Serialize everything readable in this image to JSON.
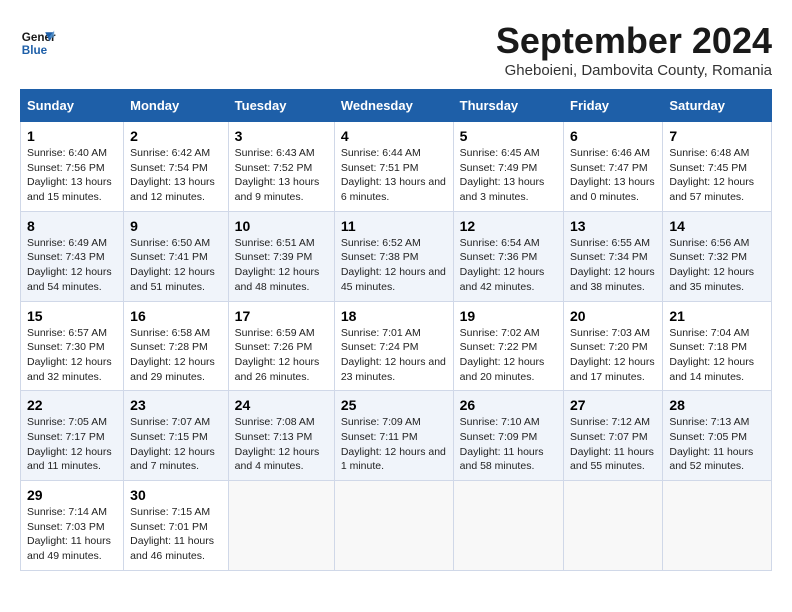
{
  "header": {
    "logo_line1": "General",
    "logo_line2": "Blue",
    "title": "September 2024",
    "subtitle": "Gheboieni, Dambovita County, Romania"
  },
  "weekdays": [
    "Sunday",
    "Monday",
    "Tuesday",
    "Wednesday",
    "Thursday",
    "Friday",
    "Saturday"
  ],
  "weeks": [
    [
      {
        "day": "1",
        "sunrise": "Sunrise: 6:40 AM",
        "sunset": "Sunset: 7:56 PM",
        "daylight": "Daylight: 13 hours and 15 minutes."
      },
      {
        "day": "2",
        "sunrise": "Sunrise: 6:42 AM",
        "sunset": "Sunset: 7:54 PM",
        "daylight": "Daylight: 13 hours and 12 minutes."
      },
      {
        "day": "3",
        "sunrise": "Sunrise: 6:43 AM",
        "sunset": "Sunset: 7:52 PM",
        "daylight": "Daylight: 13 hours and 9 minutes."
      },
      {
        "day": "4",
        "sunrise": "Sunrise: 6:44 AM",
        "sunset": "Sunset: 7:51 PM",
        "daylight": "Daylight: 13 hours and 6 minutes."
      },
      {
        "day": "5",
        "sunrise": "Sunrise: 6:45 AM",
        "sunset": "Sunset: 7:49 PM",
        "daylight": "Daylight: 13 hours and 3 minutes."
      },
      {
        "day": "6",
        "sunrise": "Sunrise: 6:46 AM",
        "sunset": "Sunset: 7:47 PM",
        "daylight": "Daylight: 13 hours and 0 minutes."
      },
      {
        "day": "7",
        "sunrise": "Sunrise: 6:48 AM",
        "sunset": "Sunset: 7:45 PM",
        "daylight": "Daylight: 12 hours and 57 minutes."
      }
    ],
    [
      {
        "day": "8",
        "sunrise": "Sunrise: 6:49 AM",
        "sunset": "Sunset: 7:43 PM",
        "daylight": "Daylight: 12 hours and 54 minutes."
      },
      {
        "day": "9",
        "sunrise": "Sunrise: 6:50 AM",
        "sunset": "Sunset: 7:41 PM",
        "daylight": "Daylight: 12 hours and 51 minutes."
      },
      {
        "day": "10",
        "sunrise": "Sunrise: 6:51 AM",
        "sunset": "Sunset: 7:39 PM",
        "daylight": "Daylight: 12 hours and 48 minutes."
      },
      {
        "day": "11",
        "sunrise": "Sunrise: 6:52 AM",
        "sunset": "Sunset: 7:38 PM",
        "daylight": "Daylight: 12 hours and 45 minutes."
      },
      {
        "day": "12",
        "sunrise": "Sunrise: 6:54 AM",
        "sunset": "Sunset: 7:36 PM",
        "daylight": "Daylight: 12 hours and 42 minutes."
      },
      {
        "day": "13",
        "sunrise": "Sunrise: 6:55 AM",
        "sunset": "Sunset: 7:34 PM",
        "daylight": "Daylight: 12 hours and 38 minutes."
      },
      {
        "day": "14",
        "sunrise": "Sunrise: 6:56 AM",
        "sunset": "Sunset: 7:32 PM",
        "daylight": "Daylight: 12 hours and 35 minutes."
      }
    ],
    [
      {
        "day": "15",
        "sunrise": "Sunrise: 6:57 AM",
        "sunset": "Sunset: 7:30 PM",
        "daylight": "Daylight: 12 hours and 32 minutes."
      },
      {
        "day": "16",
        "sunrise": "Sunrise: 6:58 AM",
        "sunset": "Sunset: 7:28 PM",
        "daylight": "Daylight: 12 hours and 29 minutes."
      },
      {
        "day": "17",
        "sunrise": "Sunrise: 6:59 AM",
        "sunset": "Sunset: 7:26 PM",
        "daylight": "Daylight: 12 hours and 26 minutes."
      },
      {
        "day": "18",
        "sunrise": "Sunrise: 7:01 AM",
        "sunset": "Sunset: 7:24 PM",
        "daylight": "Daylight: 12 hours and 23 minutes."
      },
      {
        "day": "19",
        "sunrise": "Sunrise: 7:02 AM",
        "sunset": "Sunset: 7:22 PM",
        "daylight": "Daylight: 12 hours and 20 minutes."
      },
      {
        "day": "20",
        "sunrise": "Sunrise: 7:03 AM",
        "sunset": "Sunset: 7:20 PM",
        "daylight": "Daylight: 12 hours and 17 minutes."
      },
      {
        "day": "21",
        "sunrise": "Sunrise: 7:04 AM",
        "sunset": "Sunset: 7:18 PM",
        "daylight": "Daylight: 12 hours and 14 minutes."
      }
    ],
    [
      {
        "day": "22",
        "sunrise": "Sunrise: 7:05 AM",
        "sunset": "Sunset: 7:17 PM",
        "daylight": "Daylight: 12 hours and 11 minutes."
      },
      {
        "day": "23",
        "sunrise": "Sunrise: 7:07 AM",
        "sunset": "Sunset: 7:15 PM",
        "daylight": "Daylight: 12 hours and 7 minutes."
      },
      {
        "day": "24",
        "sunrise": "Sunrise: 7:08 AM",
        "sunset": "Sunset: 7:13 PM",
        "daylight": "Daylight: 12 hours and 4 minutes."
      },
      {
        "day": "25",
        "sunrise": "Sunrise: 7:09 AM",
        "sunset": "Sunset: 7:11 PM",
        "daylight": "Daylight: 12 hours and 1 minute."
      },
      {
        "day": "26",
        "sunrise": "Sunrise: 7:10 AM",
        "sunset": "Sunset: 7:09 PM",
        "daylight": "Daylight: 11 hours and 58 minutes."
      },
      {
        "day": "27",
        "sunrise": "Sunrise: 7:12 AM",
        "sunset": "Sunset: 7:07 PM",
        "daylight": "Daylight: 11 hours and 55 minutes."
      },
      {
        "day": "28",
        "sunrise": "Sunrise: 7:13 AM",
        "sunset": "Sunset: 7:05 PM",
        "daylight": "Daylight: 11 hours and 52 minutes."
      }
    ],
    [
      {
        "day": "29",
        "sunrise": "Sunrise: 7:14 AM",
        "sunset": "Sunset: 7:03 PM",
        "daylight": "Daylight: 11 hours and 49 minutes."
      },
      {
        "day": "30",
        "sunrise": "Sunrise: 7:15 AM",
        "sunset": "Sunset: 7:01 PM",
        "daylight": "Daylight: 11 hours and 46 minutes."
      },
      null,
      null,
      null,
      null,
      null
    ]
  ]
}
